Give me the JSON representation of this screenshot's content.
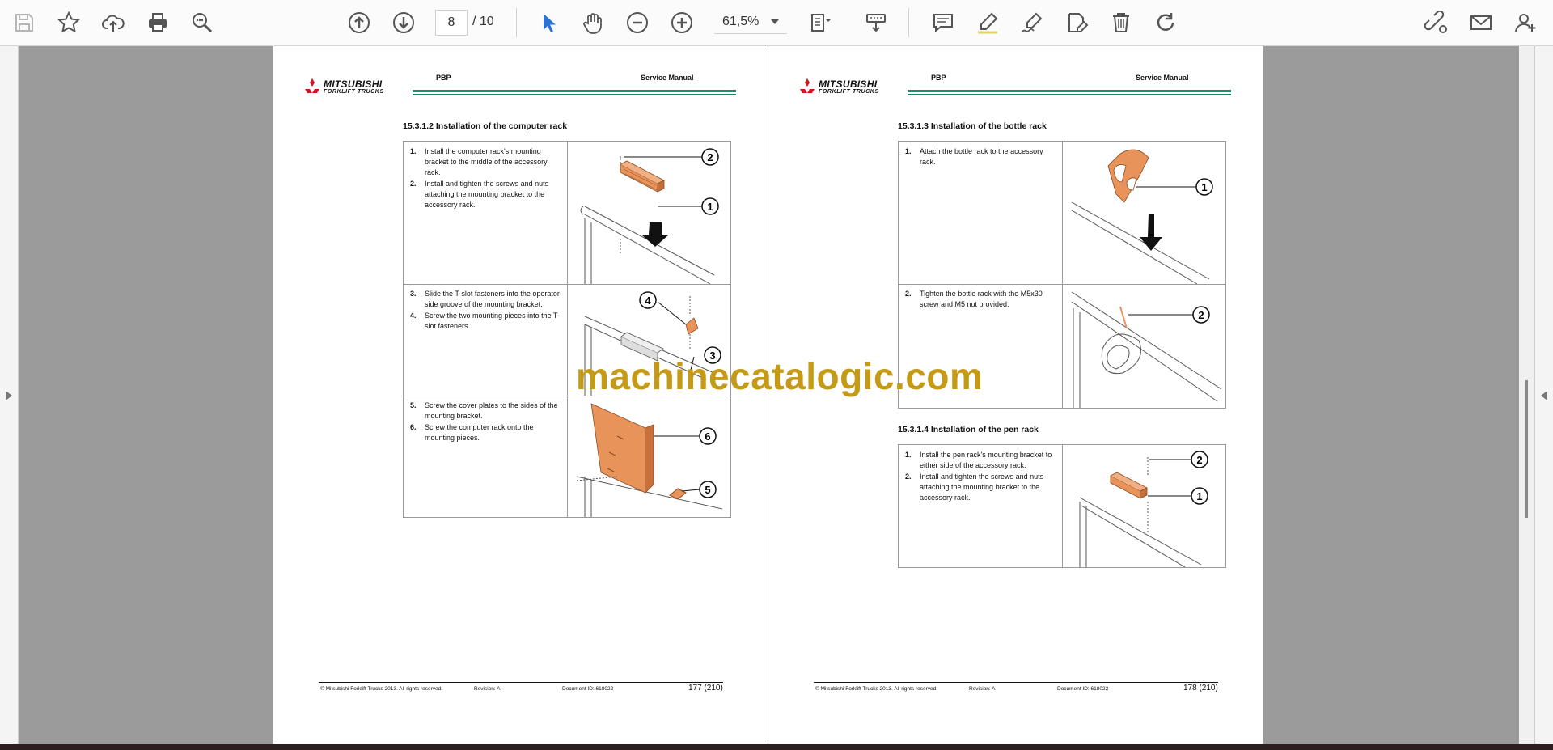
{
  "toolbar": {
    "page_current": "8",
    "page_total": "/ 10",
    "zoom": "61,5%"
  },
  "pages": [
    {
      "brand": "MITSUBISHI",
      "brand_sub": "FORKLIFT TRUCKS",
      "header_left": "PBP",
      "header_right": "Service Manual",
      "sections": [
        {
          "title": "15.3.1.2 Installation of the computer rack",
          "rows": [
            {
              "steps": [
                {
                  "n": "1.",
                  "text": "Install the computer rack's mounting bracket to the middle of the accessory rack."
                },
                {
                  "n": "2.",
                  "text": "Install and tighten the screws and nuts attaching the mounting bracket to the accessory rack."
                }
              ],
              "callouts": [
                "2",
                "1"
              ]
            },
            {
              "steps": [
                {
                  "n": "3.",
                  "text": "Slide the T-slot fasteners into the operator-side groove of the mounting bracket."
                },
                {
                  "n": "4.",
                  "text": "Screw the two mounting pieces into the T-slot fasteners."
                }
              ],
              "callouts": [
                "4",
                "3"
              ]
            },
            {
              "steps": [
                {
                  "n": "5.",
                  "text": "Screw the cover plates to the sides of the mounting bracket."
                },
                {
                  "n": "6.",
                  "text": "Screw the computer rack onto the mounting pieces."
                }
              ],
              "callouts": [
                "6",
                "5"
              ]
            }
          ]
        }
      ],
      "footer": {
        "copyright": "© Mitsubishi Forklift Trucks 2013. All rights reserved.",
        "revision": "Revision: A",
        "document": "Document ID: 618022",
        "page": "177 (210)"
      }
    },
    {
      "brand": "MITSUBISHI",
      "brand_sub": "FORKLIFT TRUCKS",
      "header_left": "PBP",
      "header_right": "Service Manual",
      "sections": [
        {
          "title": "15.3.1.3 Installation of the bottle rack",
          "rows": [
            {
              "steps": [
                {
                  "n": "1.",
                  "text": "Attach the bottle rack to the accessory rack."
                }
              ],
              "callouts": [
                "1"
              ]
            },
            {
              "steps": [
                {
                  "n": "2.",
                  "text": "Tighten the bottle rack with the M5x30 screw and M5 nut provided."
                }
              ],
              "callouts": [
                "2"
              ]
            }
          ]
        },
        {
          "title": "15.3.1.4 Installation of the pen rack",
          "rows": [
            {
              "steps": [
                {
                  "n": "1.",
                  "text": "Install the pen rack's mounting bracket to either side of the accessory rack."
                },
                {
                  "n": "2.",
                  "text": "Install and tighten the screws and nuts attaching the mounting bracket to the accessory rack."
                }
              ],
              "callouts": [
                "2",
                "1"
              ]
            }
          ]
        }
      ],
      "footer": {
        "copyright": "© Mitsubishi Forklift Trucks 2013. All rights reserved.",
        "revision": "Revision: A",
        "document": "Document ID: 618022",
        "page": "178 (210)"
      }
    }
  ],
  "watermark": "machinecatalogic.com",
  "colors": {
    "accent_blue": "#2a72d4",
    "header_green": "#1a8c6c",
    "part_orange": "#e8935a",
    "watermark_gold": "#c49a16"
  }
}
